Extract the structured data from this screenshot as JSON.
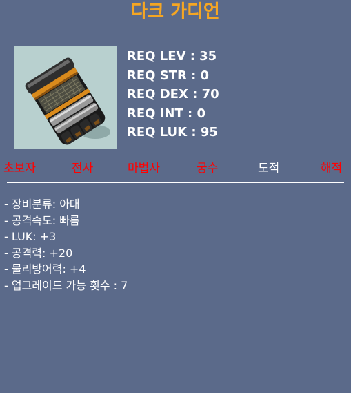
{
  "item": {
    "name": "다크 가디언",
    "icon": "dark-guardian-glove-icon"
  },
  "requirements": [
    "REQ LEV : 35",
    "REQ STR : 0",
    "REQ DEX : 70",
    "REQ INT : 0",
    "REQ LUK : 95"
  ],
  "jobs": [
    {
      "label": "초보자",
      "color": "#ff0000"
    },
    {
      "label": "전사",
      "color": "#ff0000"
    },
    {
      "label": "마법사",
      "color": "#ff0000"
    },
    {
      "label": "궁수",
      "color": "#ff0000"
    },
    {
      "label": "도적",
      "color": "#ffffff"
    },
    {
      "label": "해적",
      "color": "#ff0000"
    }
  ],
  "stats": [
    "- 장비분류: 아대",
    "- 공격속도: 빠름",
    "- LUK: +3",
    "- 공격력: +20",
    "- 물리방어력: +4",
    "- 업그레이드 가능 횟수 : 7"
  ],
  "colors": {
    "background": "#5b6a8a",
    "title": "#f5a623",
    "job_available": "#ffffff",
    "job_unavailable": "#ff0000"
  }
}
